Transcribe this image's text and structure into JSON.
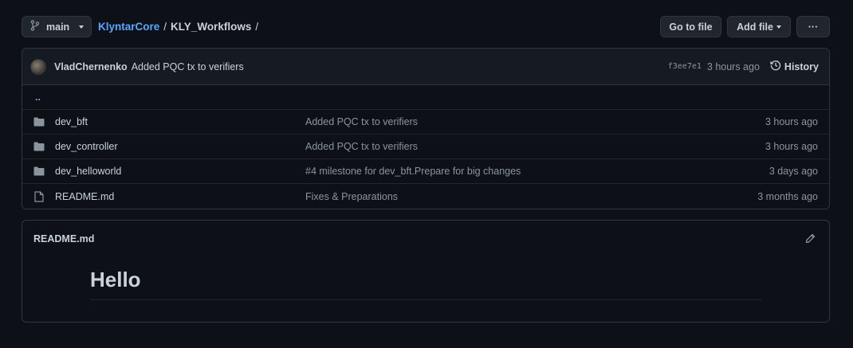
{
  "toolbar": {
    "branch": "main",
    "go_to_file": "Go to file",
    "add_file": "Add file",
    "more": "···"
  },
  "breadcrumb": {
    "root": "KlyntarCore",
    "sep1": "/",
    "dir": "KLY_Workflows",
    "sep2": "/"
  },
  "commit": {
    "author": "VladChernenko",
    "message": "Added PQC tx to verifiers",
    "sha": "f3ee7e1",
    "time": "3 hours ago",
    "history_label": "History"
  },
  "files": {
    "parent": "..",
    "rows": [
      {
        "name": "dev_bft",
        "type": "folder",
        "message": "Added PQC tx to verifiers",
        "age": "3 hours ago"
      },
      {
        "name": "dev_controller",
        "type": "folder",
        "message": "Added PQC tx to verifiers",
        "age": "3 hours ago"
      },
      {
        "name": "dev_helloworld",
        "type": "folder",
        "message": "#4 milestone for dev_bft.Prepare for big changes",
        "age": "3 days ago"
      },
      {
        "name": "README.md",
        "type": "file",
        "message": "Fixes & Preparations",
        "age": "3 months ago"
      }
    ]
  },
  "readme": {
    "title": "README.md",
    "heading": "Hello"
  },
  "colors": {
    "background": "#0d1117",
    "link": "#58a6ff",
    "border": "#30363d",
    "muted": "#8b949e"
  }
}
